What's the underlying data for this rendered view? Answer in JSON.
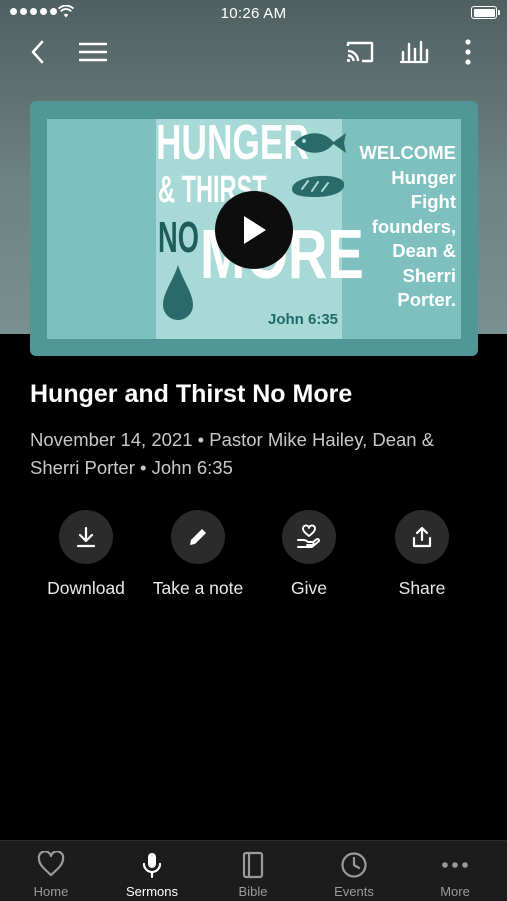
{
  "status_bar": {
    "time": "10:26 AM"
  },
  "media": {
    "art_text": {
      "hunger": "HUNGER",
      "amp_thirst": "& THIRST",
      "no": "NO",
      "more": "MORE",
      "welcome": "WELCOME\nHunger\nFight\nfounders,\nDean &\nSherri\nPorter.",
      "scripture": "John 6:35"
    }
  },
  "sermon": {
    "title": "Hunger and Thirst No More",
    "meta": "November 14, 2021 • Pastor Mike Hailey, Dean & Sherri Porter • John 6:35"
  },
  "actions": [
    {
      "label": "Download",
      "icon": "download-icon"
    },
    {
      "label": "Take a note",
      "icon": "pencil-icon"
    },
    {
      "label": "Give",
      "icon": "hand-heart-icon"
    },
    {
      "label": "Share",
      "icon": "share-icon"
    }
  ],
  "tabs": [
    {
      "label": "Home",
      "icon": "heart-icon",
      "active": false
    },
    {
      "label": "Sermons",
      "icon": "microphone-icon",
      "active": true
    },
    {
      "label": "Bible",
      "icon": "book-icon",
      "active": false
    },
    {
      "label": "Events",
      "icon": "clock-icon",
      "active": false
    },
    {
      "label": "More",
      "icon": "ellipsis-icon",
      "active": false
    }
  ],
  "colors": {
    "header_gradient_top": "#4f6060",
    "header_gradient_bottom": "#789090",
    "art_background": "#519797",
    "background": "#000000",
    "tabbar": "#1c1c1c"
  }
}
